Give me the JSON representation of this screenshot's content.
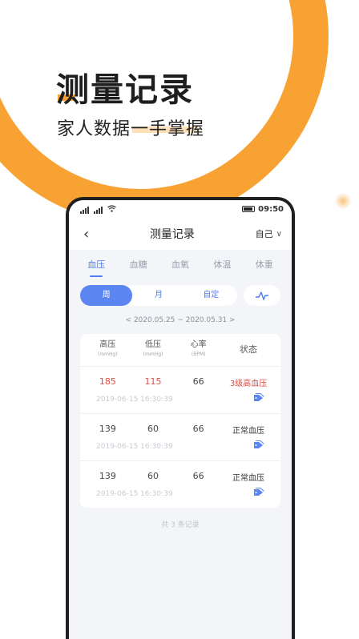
{
  "hero": {
    "title": "测量记录",
    "subtitle": "家人数据一手掌握"
  },
  "status": {
    "time": "09:50"
  },
  "nav": {
    "back": "‹",
    "title": "测量记录",
    "profile": "自己",
    "profile_chevron": "∨"
  },
  "tabs": [
    {
      "label": "血压",
      "active": true
    },
    {
      "label": "血糖",
      "active": false
    },
    {
      "label": "血氧",
      "active": false
    },
    {
      "label": "体温",
      "active": false
    },
    {
      "label": "体重",
      "active": false
    }
  ],
  "segments": [
    {
      "label": "周",
      "active": true
    },
    {
      "label": "月",
      "active": false
    },
    {
      "label": "自定",
      "active": false
    }
  ],
  "range": "< 2020.05.25 ~ 2020.05.31 >",
  "table": {
    "headers": [
      {
        "label": "高压",
        "unit": "(mmHg)"
      },
      {
        "label": "低压",
        "unit": "(mmHg)"
      },
      {
        "label": "心率",
        "unit": "(BPM)"
      },
      {
        "label": "状态",
        "unit": ""
      }
    ],
    "rows": [
      {
        "systolic": "185",
        "diastolic": "115",
        "heart_rate": "66",
        "status": "3级高血压",
        "date": "2019-06-15 16:30:39",
        "alert": true
      },
      {
        "systolic": "139",
        "diastolic": "60",
        "heart_rate": "66",
        "status": "正常血压",
        "date": "2019-06-15 16:30:39",
        "alert": false
      },
      {
        "systolic": "139",
        "diastolic": "60",
        "heart_rate": "66",
        "status": "正常血压",
        "date": "2019-06-15 16:30:39",
        "alert": false
      }
    ]
  },
  "footer": {
    "count": "共 3 条记录"
  },
  "colors": {
    "accent": "#4f7cf0",
    "brand_orange": "#f8a233",
    "alert_red": "#e04a43"
  }
}
